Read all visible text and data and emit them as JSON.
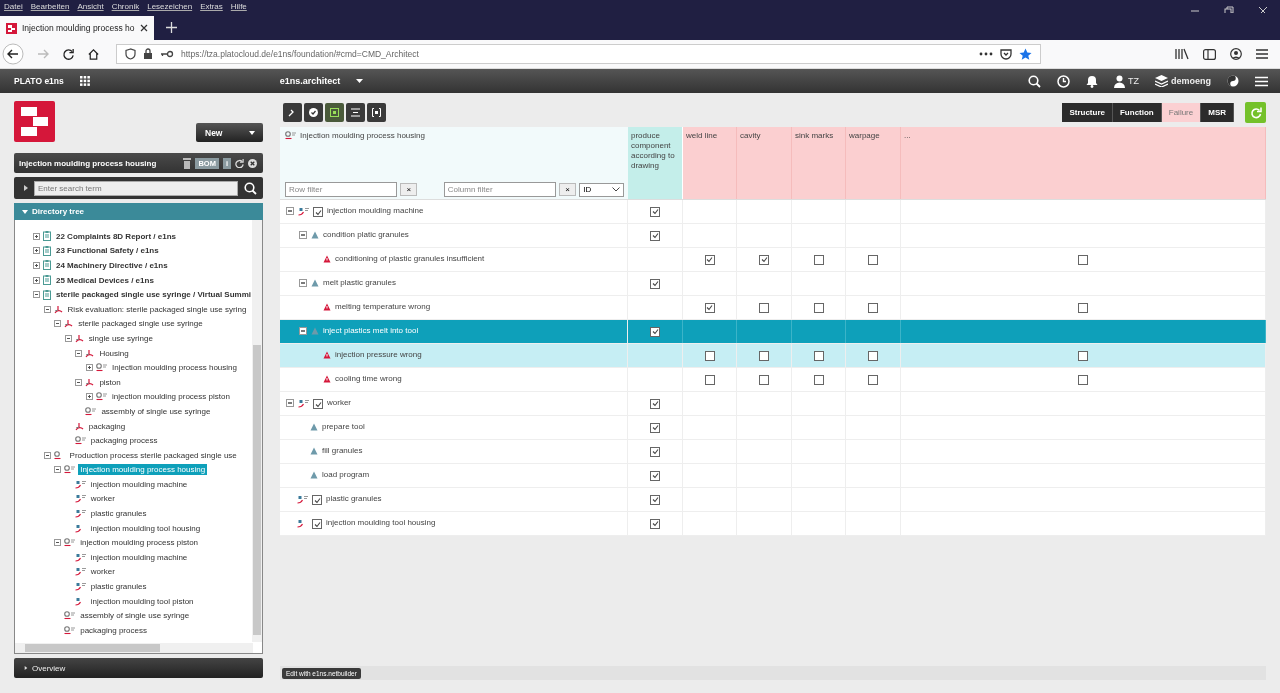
{
  "menu_bar": [
    "Datei",
    "Bearbeiten",
    "Ansicht",
    "Chronik",
    "Lesezeichen",
    "Extras",
    "Hilfe"
  ],
  "browser_tab": {
    "title": "Injection moulding process ho",
    "selected": true
  },
  "address_bar": {
    "url": "https://tza.platocloud.de/e1ns/foundation/#cmd=CMD_Architect"
  },
  "app_header": {
    "brand": "PLATO e1ns",
    "workspace": "e1ns.architect",
    "user": "TZ",
    "tenant": "demoeng"
  },
  "new_button": "New",
  "object_panel": {
    "title": "Injection moulding process housing",
    "bom": "BOM",
    "info": "i"
  },
  "search": {
    "placeholder": "Enter search term"
  },
  "directory_tree": {
    "title": "Directory tree",
    "expanded": true,
    "items": [
      {
        "label": "22 Complaints 8D Report / e1ns",
        "kind": "document",
        "expanded": false,
        "bold": true,
        "selected": false
      },
      {
        "label": "23 Functional Safety / e1ns",
        "kind": "document",
        "expanded": false,
        "bold": true,
        "selected": false
      },
      {
        "label": "24 Machinery Directive / e1ns",
        "kind": "document",
        "expanded": false,
        "bold": true,
        "selected": false
      },
      {
        "label": "25 Medical Devices / e1ns",
        "kind": "document",
        "expanded": false,
        "bold": true,
        "selected": false
      },
      {
        "label": "sterile packaged single use syringe / Virtual Summi",
        "kind": "document",
        "expanded": true,
        "bold": true,
        "selected": false,
        "children": [
          {
            "label": "Risk evaluation: sterile packaged single use syring",
            "kind": "structure",
            "expanded": true,
            "bold": false,
            "selected": false,
            "children": [
              {
                "label": "sterile packaged single use syringe",
                "kind": "structure",
                "expanded": true,
                "bold": false,
                "selected": false,
                "children": [
                  {
                    "label": "single use syringe",
                    "kind": "structure",
                    "expanded": true,
                    "bold": false,
                    "selected": false,
                    "children": [
                      {
                        "label": "Housing",
                        "kind": "structure",
                        "expanded": true,
                        "bold": false,
                        "selected": false,
                        "children": [
                          {
                            "label": "Injection moulding process housing",
                            "kind": "process",
                            "expanded": false,
                            "bold": false,
                            "selected": false
                          }
                        ]
                      },
                      {
                        "label": "piston",
                        "kind": "structure",
                        "expanded": true,
                        "bold": false,
                        "selected": false,
                        "children": [
                          {
                            "label": "injection moulding process piston",
                            "kind": "process",
                            "expanded": false,
                            "bold": false,
                            "selected": false
                          }
                        ]
                      },
                      {
                        "label": "assembly of single use syringe",
                        "kind": "process",
                        "bold": false,
                        "selected": false
                      }
                    ]
                  },
                  {
                    "label": "packaging",
                    "kind": "structure",
                    "bold": false,
                    "selected": false
                  },
                  {
                    "label": "packaging process",
                    "kind": "process",
                    "bold": false,
                    "selected": false
                  }
                ]
              }
            ]
          },
          {
            "label": "Production process sterile packaged single use",
            "kind": "process-group",
            "expanded": true,
            "bold": false,
            "selected": false,
            "children": [
              {
                "label": "Injection moulding process housing",
                "kind": "process",
                "expanded": true,
                "bold": false,
                "selected": true,
                "children": [
                  {
                    "label": "injection moulding machine",
                    "kind": "resource",
                    "bold": false,
                    "selected": false
                  },
                  {
                    "label": "worker",
                    "kind": "resource",
                    "bold": false,
                    "selected": false
                  },
                  {
                    "label": "plastic granules",
                    "kind": "resource",
                    "bold": false,
                    "selected": false
                  },
                  {
                    "label": "injection moulding tool housing",
                    "kind": "tool",
                    "bold": false,
                    "selected": false
                  }
                ]
              },
              {
                "label": "injection moulding process piston",
                "kind": "process",
                "expanded": true,
                "bold": false,
                "selected": false,
                "children": [
                  {
                    "label": "injection moulding machine",
                    "kind": "resource",
                    "bold": false,
                    "selected": false
                  },
                  {
                    "label": "worker",
                    "kind": "resource",
                    "bold": false,
                    "selected": false
                  },
                  {
                    "label": "plastic granules",
                    "kind": "resource",
                    "bold": false,
                    "selected": false
                  },
                  {
                    "label": "injection moulding tool piston",
                    "kind": "tool",
                    "bold": false,
                    "selected": false
                  }
                ]
              },
              {
                "label": "assembly of single use syringe",
                "kind": "process",
                "bold": false,
                "selected": false
              },
              {
                "label": "packaging process",
                "kind": "process",
                "bold": false,
                "selected": false
              }
            ]
          }
        ]
      }
    ]
  },
  "overview": {
    "title": "Overview",
    "expanded": false
  },
  "view_tabs": [
    {
      "label": "Structure",
      "selected": false
    },
    {
      "label": "Function",
      "selected": false
    },
    {
      "label": "Failure",
      "selected": true
    },
    {
      "label": "MSR",
      "selected": false
    }
  ],
  "matrix": {
    "title": "Injection moulding process housing",
    "function_column": "produce component according to drawing",
    "failure_columns": [
      "weld line",
      "cavity",
      "sink marks",
      "warpage",
      "..."
    ],
    "row_filter": {
      "placeholder": "Row filter",
      "clear": "×"
    },
    "column_filter": {
      "placeholder": "Column filter",
      "clear": "×"
    },
    "id_select": "ID",
    "rows": [
      {
        "label": "injection moulding machine",
        "kind": "resource",
        "expanded": true,
        "checked": true,
        "function_check": true,
        "selected": false,
        "hovered": false,
        "children": [
          {
            "label": "condition platic granules",
            "kind": "function",
            "expanded": true,
            "function_check": true,
            "selected": false,
            "hovered": false,
            "children": [
              {
                "label": "conditioning of plastic granules insufficient",
                "kind": "failure",
                "selected": false,
                "hovered": false,
                "failure_checks": [
                  true,
                  true,
                  false,
                  false,
                  false
                ]
              }
            ]
          },
          {
            "label": "melt plastic granules",
            "kind": "function",
            "expanded": true,
            "function_check": true,
            "selected": false,
            "hovered": false,
            "children": [
              {
                "label": "melting temperature wrong",
                "kind": "failure",
                "selected": false,
                "hovered": false,
                "failure_checks": [
                  true,
                  false,
                  false,
                  false,
                  false
                ]
              }
            ]
          },
          {
            "label": "inject plastics melt into tool",
            "kind": "function",
            "expanded": true,
            "function_check": true,
            "selected": true,
            "hovered": false,
            "children": [
              {
                "label": "injection pressure wrong",
                "kind": "failure",
                "selected": false,
                "hovered": true,
                "failure_checks": [
                  false,
                  false,
                  false,
                  false,
                  false
                ]
              },
              {
                "label": "cooling time wrong",
                "kind": "failure",
                "selected": false,
                "hovered": false,
                "failure_checks": [
                  false,
                  false,
                  false,
                  false,
                  false
                ]
              }
            ]
          }
        ]
      },
      {
        "label": "worker",
        "kind": "resource",
        "expanded": true,
        "checked": true,
        "function_check": true,
        "selected": false,
        "hovered": false,
        "children": [
          {
            "label": "prepare tool",
            "kind": "function",
            "function_check": true,
            "selected": false,
            "hovered": false
          },
          {
            "label": "fill granules",
            "kind": "function",
            "function_check": true,
            "selected": false,
            "hovered": false
          },
          {
            "label": "load program",
            "kind": "function",
            "function_check": true,
            "selected": false,
            "hovered": false
          }
        ]
      },
      {
        "label": "plastic granules",
        "kind": "resource",
        "checked": true,
        "function_check": true,
        "selected": false,
        "hovered": false
      },
      {
        "label": "injection moulding tool housing",
        "kind": "tool",
        "checked": true,
        "function_check": true,
        "selected": false,
        "hovered": false
      }
    ]
  },
  "footer_button": "Edit with e1ns.netbuilder"
}
